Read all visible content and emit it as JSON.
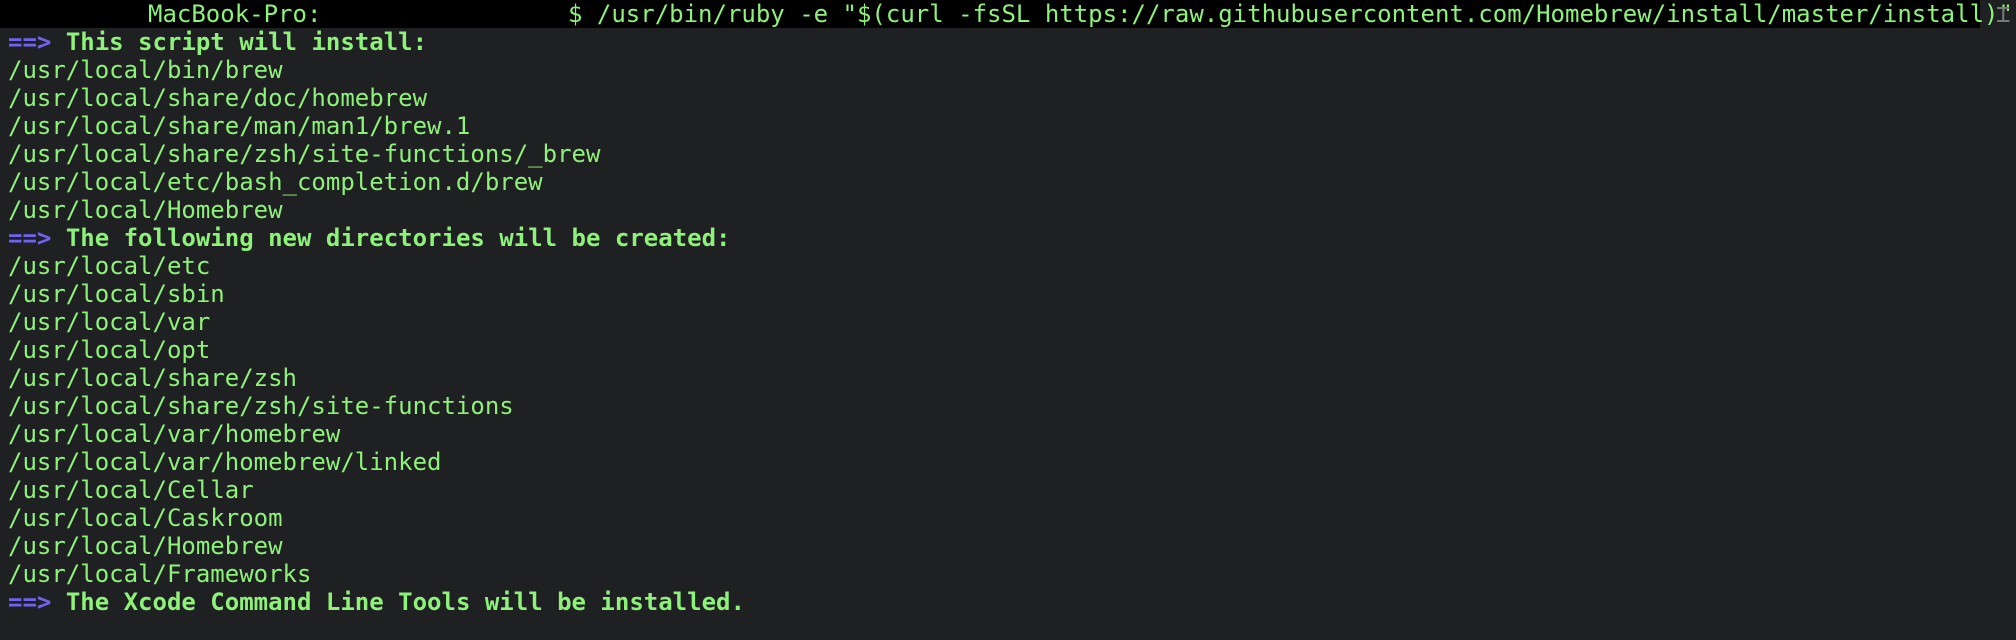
{
  "terminal": {
    "prompt": {
      "host": "MacBook-Pro:",
      "command": "$ /usr/bin/ruby -e \"$(curl -fsSL https://raw.githubusercontent.com/Homebrew/install/master/install)\""
    },
    "arrow": "==>",
    "sections": [
      {
        "heading": "This script will install:",
        "paths": [
          "/usr/local/bin/brew",
          "/usr/local/share/doc/homebrew",
          "/usr/local/share/man/man1/brew.1",
          "/usr/local/share/zsh/site-functions/_brew",
          "/usr/local/etc/bash_completion.d/brew",
          "/usr/local/Homebrew"
        ]
      },
      {
        "heading": "The following new directories will be created:",
        "paths": [
          "/usr/local/etc",
          "/usr/local/sbin",
          "/usr/local/var",
          "/usr/local/opt",
          "/usr/local/share/zsh",
          "/usr/local/share/zsh/site-functions",
          "/usr/local/var/homebrew",
          "/usr/local/var/homebrew/linked",
          "/usr/local/Cellar",
          "/usr/local/Caskroom",
          "/usr/local/Homebrew",
          "/usr/local/Frameworks"
        ]
      },
      {
        "heading": "The Xcode Command Line Tools will be installed.",
        "paths": []
      }
    ],
    "colors": {
      "background": "#1f2022",
      "text": "#8ef27a",
      "arrow": "#6f62f0",
      "prompt_bar": "#000000"
    }
  }
}
